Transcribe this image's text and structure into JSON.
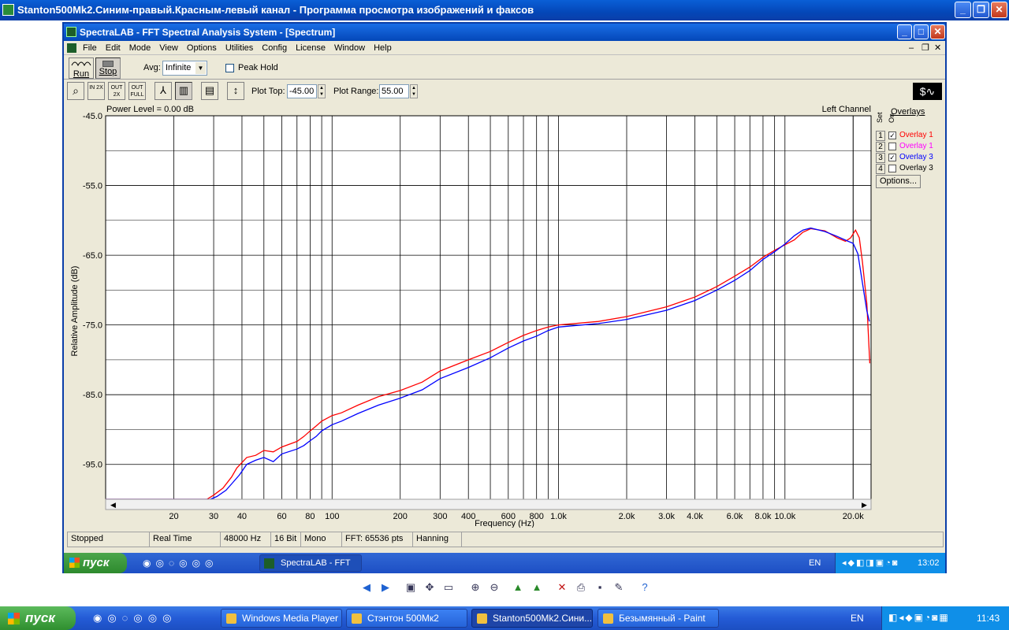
{
  "outer_window": {
    "title": "Stanton500Mk2.Синим-правый.Красным-левый канал - Программа просмотра изображений и факсов"
  },
  "app": {
    "title": "SpectraLAB - FFT Spectral Analysis System - [Spectrum]",
    "menu": [
      "File",
      "Edit",
      "Mode",
      "View",
      "Options",
      "Utilities",
      "Config",
      "License",
      "Window",
      "Help"
    ],
    "toolbar": {
      "run_label": "Run",
      "stop_label": "Stop",
      "avg_label": "Avg:",
      "avg_value": "Infinite",
      "peak_hold_label": "Peak Hold",
      "plot_top_label": "Plot Top:",
      "plot_top_value": "-45.00",
      "plot_range_label": "Plot Range:",
      "plot_range_value": "55.00",
      "zoom_labels": [
        "IN 2X",
        "OUT 2X",
        "OUT FULL"
      ]
    },
    "plot_header": {
      "power_level": "Power Level = 0.00 dB",
      "channel": "Left Channel"
    },
    "overlays": {
      "title": "Overlays",
      "set_label": "Set",
      "on_label": "On",
      "items": [
        {
          "num": "1",
          "checked": true,
          "name": "Overlay 1",
          "color": "#ff0000"
        },
        {
          "num": "2",
          "checked": false,
          "name": "Overlay 1",
          "color": "#ff00ff"
        },
        {
          "num": "3",
          "checked": true,
          "name": "Overlay 3",
          "color": "#0000ff"
        },
        {
          "num": "4",
          "checked": false,
          "name": "Overlay 3",
          "color": "#000000"
        }
      ],
      "options_label": "Options..."
    },
    "status": [
      "Stopped",
      "Real Time",
      "48000 Hz",
      "16 Bit",
      "Mono",
      "FFT: 65536 pts",
      "Hanning"
    ]
  },
  "chart_data": {
    "type": "line",
    "xlabel": "Frequency (Hz)",
    "ylabel": "Relative Amplitude (dB)",
    "xscale": "log",
    "xlim": [
      10,
      24000
    ],
    "ylim": [
      -100,
      -45
    ],
    "y_ticks": [
      "-45.0",
      "-55.0",
      "-65.0",
      "-75.0",
      "-85.0",
      "-95.0"
    ],
    "x_ticks": [
      {
        "v": 20,
        "t": "20"
      },
      {
        "v": 30,
        "t": "30"
      },
      {
        "v": 40,
        "t": "40"
      },
      {
        "v": 60,
        "t": "60"
      },
      {
        "v": 80,
        "t": "80"
      },
      {
        "v": 100,
        "t": "100"
      },
      {
        "v": 200,
        "t": "200"
      },
      {
        "v": 300,
        "t": "300"
      },
      {
        "v": 400,
        "t": "400"
      },
      {
        "v": 600,
        "t": "600"
      },
      {
        "v": 800,
        "t": "800"
      },
      {
        "v": 1000,
        "t": "1.0k"
      },
      {
        "v": 2000,
        "t": "2.0k"
      },
      {
        "v": 3000,
        "t": "3.0k"
      },
      {
        "v": 4000,
        "t": "4.0k"
      },
      {
        "v": 6000,
        "t": "6.0k"
      },
      {
        "v": 8000,
        "t": "8.0k"
      },
      {
        "v": 10000,
        "t": "10.0k"
      },
      {
        "v": 20000,
        "t": "20.0k"
      }
    ],
    "series": [
      {
        "name": "Overlay 1",
        "color": "#ff0000",
        "points": [
          [
            10,
            -100
          ],
          [
            28,
            -100
          ],
          [
            30,
            -99.4
          ],
          [
            33,
            -98.4
          ],
          [
            36,
            -96.8
          ],
          [
            38,
            -95.5
          ],
          [
            42,
            -94
          ],
          [
            46,
            -93.7
          ],
          [
            50,
            -93
          ],
          [
            55,
            -93.2
          ],
          [
            60,
            -92.5
          ],
          [
            70,
            -91.7
          ],
          [
            75,
            -91
          ],
          [
            80,
            -90.2
          ],
          [
            85,
            -89.5
          ],
          [
            90,
            -88.8
          ],
          [
            100,
            -88
          ],
          [
            110,
            -87.6
          ],
          [
            130,
            -86.5
          ],
          [
            160,
            -85.3
          ],
          [
            200,
            -84.4
          ],
          [
            250,
            -83.2
          ],
          [
            300,
            -81.6
          ],
          [
            400,
            -80
          ],
          [
            500,
            -78.8
          ],
          [
            600,
            -77.5
          ],
          [
            700,
            -76.5
          ],
          [
            800,
            -75.8
          ],
          [
            900,
            -75.3
          ],
          [
            1000,
            -75
          ],
          [
            1500,
            -74.5
          ],
          [
            2000,
            -73.8
          ],
          [
            3000,
            -72.4
          ],
          [
            4000,
            -71
          ],
          [
            5000,
            -69.5
          ],
          [
            6000,
            -68
          ],
          [
            7000,
            -66.7
          ],
          [
            8000,
            -65.3
          ],
          [
            9000,
            -64.3
          ],
          [
            10000,
            -63.5
          ],
          [
            11000,
            -62.8
          ],
          [
            12000,
            -61.7
          ],
          [
            13000,
            -61.2
          ],
          [
            15000,
            -61.5
          ],
          [
            17000,
            -62.5
          ],
          [
            18500,
            -63
          ],
          [
            19500,
            -62.5
          ],
          [
            20500,
            -61.4
          ],
          [
            21300,
            -62.5
          ],
          [
            22000,
            -66
          ],
          [
            23000,
            -72
          ],
          [
            23700,
            -80.5
          ]
        ]
      },
      {
        "name": "Overlay 3",
        "color": "#0000ff",
        "points": [
          [
            10,
            -100
          ],
          [
            29,
            -100
          ],
          [
            31,
            -99.6
          ],
          [
            34,
            -98.7
          ],
          [
            36,
            -97.8
          ],
          [
            39,
            -96.5
          ],
          [
            42,
            -95
          ],
          [
            46,
            -94.4
          ],
          [
            50,
            -94
          ],
          [
            55,
            -94.6
          ],
          [
            60,
            -93.5
          ],
          [
            70,
            -92.8
          ],
          [
            75,
            -92.3
          ],
          [
            80,
            -91.6
          ],
          [
            85,
            -91
          ],
          [
            90,
            -90.2
          ],
          [
            100,
            -89.3
          ],
          [
            110,
            -88.8
          ],
          [
            130,
            -87.7
          ],
          [
            160,
            -86.5
          ],
          [
            200,
            -85.5
          ],
          [
            250,
            -84.3
          ],
          [
            300,
            -82.7
          ],
          [
            400,
            -81.1
          ],
          [
            500,
            -79.7
          ],
          [
            600,
            -78.3
          ],
          [
            700,
            -77.3
          ],
          [
            800,
            -76.6
          ],
          [
            900,
            -75.8
          ],
          [
            1000,
            -75.3
          ],
          [
            1500,
            -74.8
          ],
          [
            2000,
            -74.2
          ],
          [
            3000,
            -72.9
          ],
          [
            4000,
            -71.5
          ],
          [
            5000,
            -70
          ],
          [
            6000,
            -68.6
          ],
          [
            7000,
            -67.2
          ],
          [
            8000,
            -65.6
          ],
          [
            9000,
            -64.5
          ],
          [
            10000,
            -63.4
          ],
          [
            11000,
            -62.2
          ],
          [
            12000,
            -61.4
          ],
          [
            13000,
            -61.1
          ],
          [
            15000,
            -61.6
          ],
          [
            17000,
            -62.3
          ],
          [
            19000,
            -63
          ],
          [
            20000,
            -63.3
          ],
          [
            21000,
            -64.8
          ],
          [
            22000,
            -69
          ],
          [
            23000,
            -73
          ],
          [
            23600,
            -74.5
          ]
        ]
      }
    ]
  },
  "inner_taskbar": {
    "start_label": "пуск",
    "window_label": "SpectraLAB - FFT Spe...",
    "lang": "EN",
    "clock": "13:02"
  },
  "viewer_toolbar": {
    "icons": [
      "prev-icon",
      "next-icon",
      "best-fit-icon",
      "actual-size-icon",
      "slideshow-icon",
      "zoom-in-icon",
      "zoom-out-icon",
      "rotate-cw-icon",
      "rotate-ccw-icon",
      "delete-icon",
      "print-icon",
      "save-icon",
      "edit-icon",
      "help-icon"
    ]
  },
  "taskbar": {
    "start_label": "пуск",
    "windows": [
      {
        "label": "Windows Media Player",
        "active": false
      },
      {
        "label": "Стэнтон 500Мк2",
        "active": false
      },
      {
        "label": "Stanton500Mk2.Сини...",
        "active": true
      },
      {
        "label": "Безымянный - Paint",
        "active": false
      }
    ],
    "lang": "EN",
    "clock": "11:43"
  }
}
